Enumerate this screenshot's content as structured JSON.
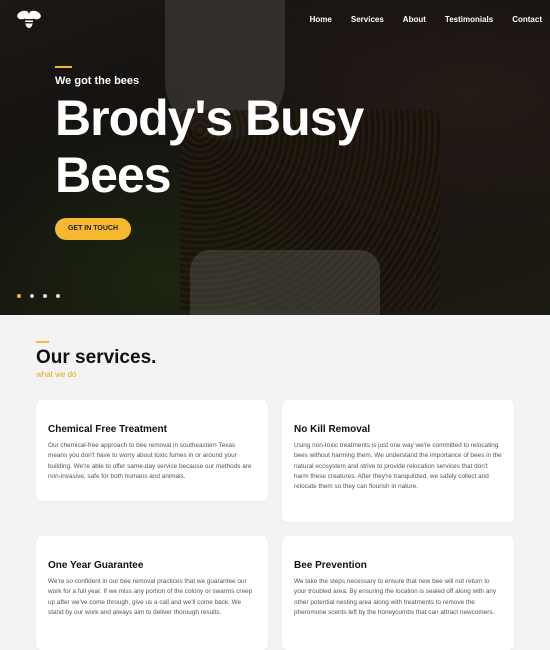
{
  "brand": {
    "logo_icon": "bee-logo-icon",
    "accent": "#f5b82e"
  },
  "nav": {
    "items": [
      "Home",
      "Services",
      "About",
      "Testimonials",
      "Contact"
    ]
  },
  "hero": {
    "eyebrow": "We got the bees",
    "title": "Brody's Busy Bees",
    "cta_label": "GET IN TOUCH",
    "slides_count": 4,
    "active_slide": 1
  },
  "services": {
    "title": "Our services.",
    "subtitle": "what we do",
    "cards": [
      {
        "title": "Chemical Free Treatment",
        "text": "Our chemical-free approach to bee removal in southeastern Texas means you don't have to worry about toxic fumes in or around your building. We're able to offer same-day service because our methods are non-invasive, safe for both humans and animals."
      },
      {
        "title": "No Kill Removal",
        "text": "Using non-toxic treatments is just one way we're committed to relocating bees without harming them. We understand the importance of bees in the natural ecosystem and strive to provide relocation services that don't harm these creatures. After they're tranquilized, we safely collect and relocate them so they can flourish in nature."
      },
      {
        "title": "One Year Guarantee",
        "text": "We're so confident in our bee removal practices that we guarantee our work for a full year. If we miss any portion of the colony or swarms creep up after we've come through, give us a call and we'll come back. We stand by our work and always aim to deliver thorough results."
      },
      {
        "title": "Bee Prevention",
        "text": "We take the steps necessary to ensure that new bee will not return to your troubled area. By ensuring the location is sealed off along with any other potential nesting area along with treatments to remove the pheromone scents left by the honeycombs that can attract newcomers."
      }
    ]
  }
}
